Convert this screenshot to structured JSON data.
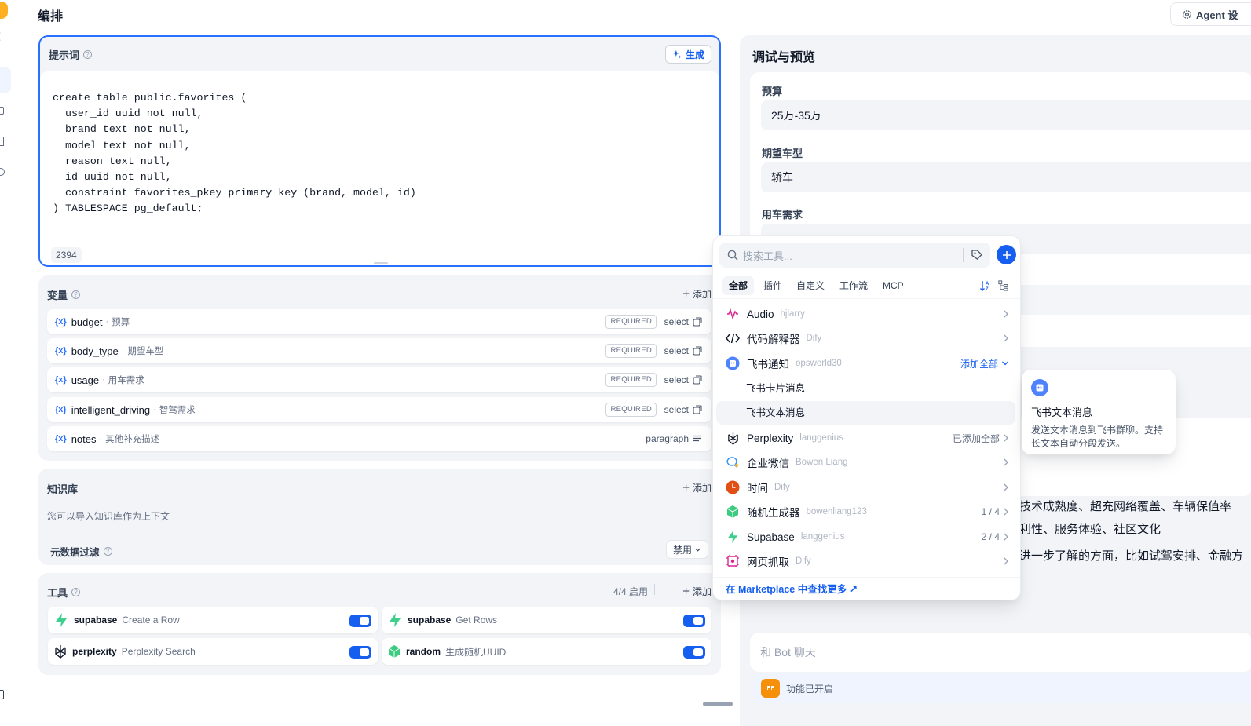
{
  "header": {
    "title": "编排",
    "agent_button_label": "Agent 设"
  },
  "prompt": {
    "title": "提示词",
    "generate_label": "生成",
    "code": "create table public.favorites (\n  user_id uuid not null,\n  brand text not null,\n  model text not null,\n  reason text null,\n  id uuid not null,\n  constraint favorites_pkey primary key (brand, model, id)\n) TABLESPACE pg_default;",
    "count": "2394"
  },
  "variables": {
    "title": "变量",
    "add_label": "添加",
    "items": [
      {
        "name": "budget",
        "label": "预算",
        "required": "REQUIRED",
        "type": "select"
      },
      {
        "name": "body_type",
        "label": "期望车型",
        "required": "REQUIRED",
        "type": "select"
      },
      {
        "name": "usage",
        "label": "用车需求",
        "required": "REQUIRED",
        "type": "select"
      },
      {
        "name": "intelligent_driving",
        "label": "智驾需求",
        "required": "REQUIRED",
        "type": "select"
      },
      {
        "name": "notes",
        "label": "其他补充描述",
        "required": "",
        "type": "paragraph"
      }
    ]
  },
  "knowledge": {
    "title": "知识库",
    "add_label": "添加",
    "hint": "您可以导入知识库作为上下文",
    "metadata_filter_label": "元数据过滤",
    "metadata_filter_value": "禁用"
  },
  "tools": {
    "title": "工具",
    "status": "4/4 启用",
    "add_label": "添加",
    "items": [
      {
        "provider": "supabase",
        "action": "Create a Row",
        "icon": "supabase-icon"
      },
      {
        "provider": "supabase",
        "action": "Get Rows",
        "icon": "supabase-icon"
      },
      {
        "provider": "perplexity",
        "action": "Perplexity Search",
        "icon": "perplexity-icon"
      },
      {
        "provider": "random",
        "action": "生成随机UUID",
        "icon": "random-icon"
      }
    ]
  },
  "preview": {
    "title": "调试与预览",
    "fields": [
      {
        "label": "预算",
        "value": "25万-35万"
      },
      {
        "label": "期望车型",
        "value": "轿车"
      },
      {
        "label": "用车需求",
        "value": ""
      }
    ],
    "answer_lines": [
      "技术成熟度、超充网络覆盖、车辆保值率",
      "利性、服务体验、社区文化",
      "进一步了解的方面，比如试驾安排、金融方"
    ],
    "chat_placeholder": "和 Bot 聊天",
    "feature_label": "功能已开启"
  },
  "tool_popup": {
    "search_placeholder": "搜索工具...",
    "tabs": [
      "全部",
      "插件",
      "自定义",
      "工作流",
      "MCP"
    ],
    "active_tab": "全部",
    "items": [
      {
        "name": "Audio",
        "author": "hjlarry",
        "right": "",
        "icon": "audio-icon",
        "color": "#dd2590"
      },
      {
        "name": "代码解释器",
        "author": "Dify",
        "right": "",
        "icon": "code-icon",
        "color": "#101828"
      },
      {
        "name": "飞书通知",
        "author": "opsworld30",
        "right": "添加全部",
        "icon": "feishu-icon",
        "color": "#4e83fd"
      },
      {
        "name": "Perplexity",
        "author": "langgenius",
        "right": "已添加全部",
        "icon": "perplexity-icon",
        "color": "#101828"
      },
      {
        "name": "企业微信",
        "author": "Bowen Liang",
        "right": "",
        "icon": "wecom-icon",
        "color": "#2e90fa"
      },
      {
        "name": "时间",
        "author": "Dify",
        "right": "",
        "icon": "clock-icon",
        "color": "#e04f16"
      },
      {
        "name": "随机生成器",
        "author": "bowenliang123",
        "right": "1 / 4",
        "icon": "random-icon",
        "color": "#3ccb7f"
      },
      {
        "name": "Supabase",
        "author": "langgenius",
        "right": "2 / 4",
        "icon": "supabase-icon",
        "color": "#3ecf8e"
      },
      {
        "name": "网页抓取",
        "author": "Dify",
        "right": "",
        "icon": "webscraper-icon",
        "color": "#dd2590"
      }
    ],
    "sub_items": [
      "飞书卡片消息",
      "飞书文本消息"
    ],
    "marketplace_link": "在 Marketplace 中查找更多 ↗"
  },
  "tooltip": {
    "title": "飞书文本消息",
    "description": "发送文本消息到飞书群聊。支持长文本自动分段发送。"
  }
}
